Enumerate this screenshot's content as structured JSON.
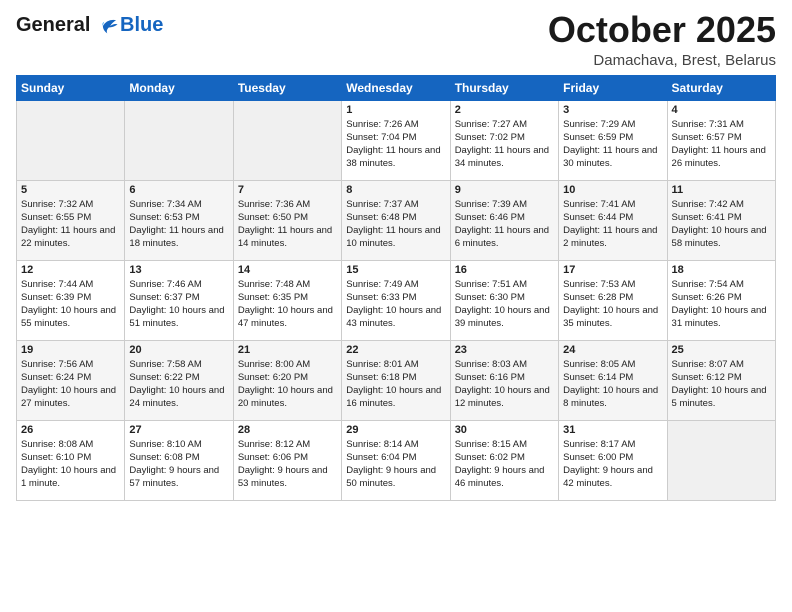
{
  "header": {
    "logo_line1": "General",
    "logo_line2": "Blue",
    "month_title": "October 2025",
    "location": "Damachava, Brest, Belarus"
  },
  "days_of_week": [
    "Sunday",
    "Monday",
    "Tuesday",
    "Wednesday",
    "Thursday",
    "Friday",
    "Saturday"
  ],
  "weeks": [
    [
      {
        "day": "",
        "info": ""
      },
      {
        "day": "",
        "info": ""
      },
      {
        "day": "",
        "info": ""
      },
      {
        "day": "1",
        "info": "Sunrise: 7:26 AM\nSunset: 7:04 PM\nDaylight: 11 hours\nand 38 minutes."
      },
      {
        "day": "2",
        "info": "Sunrise: 7:27 AM\nSunset: 7:02 PM\nDaylight: 11 hours\nand 34 minutes."
      },
      {
        "day": "3",
        "info": "Sunrise: 7:29 AM\nSunset: 6:59 PM\nDaylight: 11 hours\nand 30 minutes."
      },
      {
        "day": "4",
        "info": "Sunrise: 7:31 AM\nSunset: 6:57 PM\nDaylight: 11 hours\nand 26 minutes."
      }
    ],
    [
      {
        "day": "5",
        "info": "Sunrise: 7:32 AM\nSunset: 6:55 PM\nDaylight: 11 hours\nand 22 minutes."
      },
      {
        "day": "6",
        "info": "Sunrise: 7:34 AM\nSunset: 6:53 PM\nDaylight: 11 hours\nand 18 minutes."
      },
      {
        "day": "7",
        "info": "Sunrise: 7:36 AM\nSunset: 6:50 PM\nDaylight: 11 hours\nand 14 minutes."
      },
      {
        "day": "8",
        "info": "Sunrise: 7:37 AM\nSunset: 6:48 PM\nDaylight: 11 hours\nand 10 minutes."
      },
      {
        "day": "9",
        "info": "Sunrise: 7:39 AM\nSunset: 6:46 PM\nDaylight: 11 hours\nand 6 minutes."
      },
      {
        "day": "10",
        "info": "Sunrise: 7:41 AM\nSunset: 6:44 PM\nDaylight: 11 hours\nand 2 minutes."
      },
      {
        "day": "11",
        "info": "Sunrise: 7:42 AM\nSunset: 6:41 PM\nDaylight: 10 hours\nand 58 minutes."
      }
    ],
    [
      {
        "day": "12",
        "info": "Sunrise: 7:44 AM\nSunset: 6:39 PM\nDaylight: 10 hours\nand 55 minutes."
      },
      {
        "day": "13",
        "info": "Sunrise: 7:46 AM\nSunset: 6:37 PM\nDaylight: 10 hours\nand 51 minutes."
      },
      {
        "day": "14",
        "info": "Sunrise: 7:48 AM\nSunset: 6:35 PM\nDaylight: 10 hours\nand 47 minutes."
      },
      {
        "day": "15",
        "info": "Sunrise: 7:49 AM\nSunset: 6:33 PM\nDaylight: 10 hours\nand 43 minutes."
      },
      {
        "day": "16",
        "info": "Sunrise: 7:51 AM\nSunset: 6:30 PM\nDaylight: 10 hours\nand 39 minutes."
      },
      {
        "day": "17",
        "info": "Sunrise: 7:53 AM\nSunset: 6:28 PM\nDaylight: 10 hours\nand 35 minutes."
      },
      {
        "day": "18",
        "info": "Sunrise: 7:54 AM\nSunset: 6:26 PM\nDaylight: 10 hours\nand 31 minutes."
      }
    ],
    [
      {
        "day": "19",
        "info": "Sunrise: 7:56 AM\nSunset: 6:24 PM\nDaylight: 10 hours\nand 27 minutes."
      },
      {
        "day": "20",
        "info": "Sunrise: 7:58 AM\nSunset: 6:22 PM\nDaylight: 10 hours\nand 24 minutes."
      },
      {
        "day": "21",
        "info": "Sunrise: 8:00 AM\nSunset: 6:20 PM\nDaylight: 10 hours\nand 20 minutes."
      },
      {
        "day": "22",
        "info": "Sunrise: 8:01 AM\nSunset: 6:18 PM\nDaylight: 10 hours\nand 16 minutes."
      },
      {
        "day": "23",
        "info": "Sunrise: 8:03 AM\nSunset: 6:16 PM\nDaylight: 10 hours\nand 12 minutes."
      },
      {
        "day": "24",
        "info": "Sunrise: 8:05 AM\nSunset: 6:14 PM\nDaylight: 10 hours\nand 8 minutes."
      },
      {
        "day": "25",
        "info": "Sunrise: 8:07 AM\nSunset: 6:12 PM\nDaylight: 10 hours\nand 5 minutes."
      }
    ],
    [
      {
        "day": "26",
        "info": "Sunrise: 8:08 AM\nSunset: 6:10 PM\nDaylight: 10 hours\nand 1 minute."
      },
      {
        "day": "27",
        "info": "Sunrise: 8:10 AM\nSunset: 6:08 PM\nDaylight: 9 hours\nand 57 minutes."
      },
      {
        "day": "28",
        "info": "Sunrise: 8:12 AM\nSunset: 6:06 PM\nDaylight: 9 hours\nand 53 minutes."
      },
      {
        "day": "29",
        "info": "Sunrise: 8:14 AM\nSunset: 6:04 PM\nDaylight: 9 hours\nand 50 minutes."
      },
      {
        "day": "30",
        "info": "Sunrise: 8:15 AM\nSunset: 6:02 PM\nDaylight: 9 hours\nand 46 minutes."
      },
      {
        "day": "31",
        "info": "Sunrise: 8:17 AM\nSunset: 6:00 PM\nDaylight: 9 hours\nand 42 minutes."
      },
      {
        "day": "",
        "info": ""
      }
    ]
  ]
}
